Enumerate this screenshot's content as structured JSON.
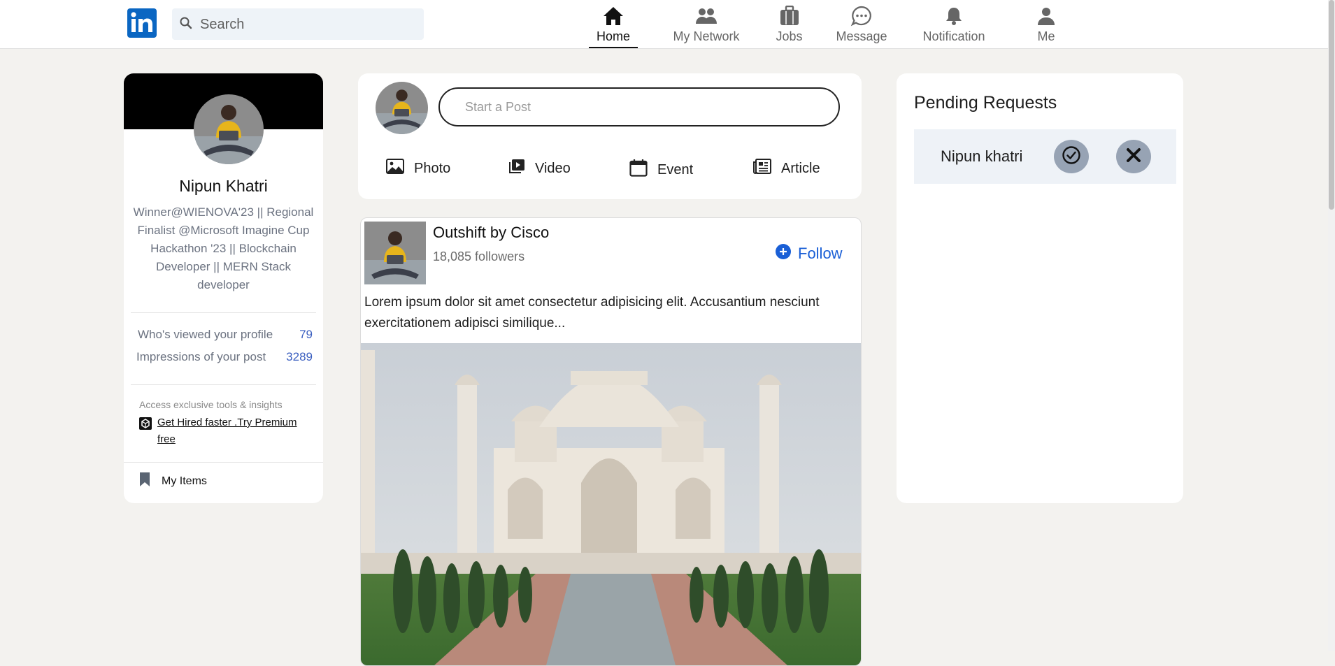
{
  "header": {
    "logo_text": "in",
    "search": {
      "placeholder": "Search",
      "value": ""
    },
    "nav": [
      {
        "label": "Home",
        "icon": "home-icon",
        "active": true
      },
      {
        "label": "My Network",
        "icon": "people-icon",
        "active": false
      },
      {
        "label": "Jobs",
        "icon": "briefcase-icon",
        "active": false
      },
      {
        "label": "Message",
        "icon": "message-icon",
        "active": false
      },
      {
        "label": "Notification",
        "icon": "bell-icon",
        "active": false
      },
      {
        "label": "Me",
        "icon": "person-icon",
        "active": false
      }
    ]
  },
  "profile": {
    "name": "Nipun Khatri",
    "headline": "Winner@WIENOVA'23 || Regional Finalist @Microsoft Imagine Cup Hackathon '23 || Blockchain Developer || MERN Stack developer",
    "stats": [
      {
        "label": "Who's viewed your profile",
        "value": "79"
      },
      {
        "label": "Impressions of your post",
        "value": "3289"
      }
    ],
    "premium_note": "Access exclusive tools & insights",
    "premium_link": "Get Hired faster .Try Premium free",
    "my_items": "My Items"
  },
  "composer": {
    "placeholder": "Start a Post",
    "actions": [
      {
        "label": "Photo",
        "icon": "photo-icon"
      },
      {
        "label": "Video",
        "icon": "video-icon"
      },
      {
        "label": "Event",
        "icon": "calendar-icon"
      },
      {
        "label": "Article",
        "icon": "newspaper-icon"
      }
    ]
  },
  "post": {
    "org_name": "Outshift by Cisco",
    "followers": "18,085 followers",
    "follow_label": "Follow",
    "text": "Lorem ipsum dolor sit amet consectetur adipisicing elit. Accusantium nesciunt exercitationem adipisci similique..."
  },
  "pending": {
    "title": "Pending Requests",
    "requests": [
      {
        "name": "Nipun khatri"
      }
    ]
  },
  "colors": {
    "brand": "#0a66c2",
    "link_blue": "#1a5fd6",
    "stat_blue": "#3b5fc0",
    "page_bg": "#f3f2ef"
  }
}
